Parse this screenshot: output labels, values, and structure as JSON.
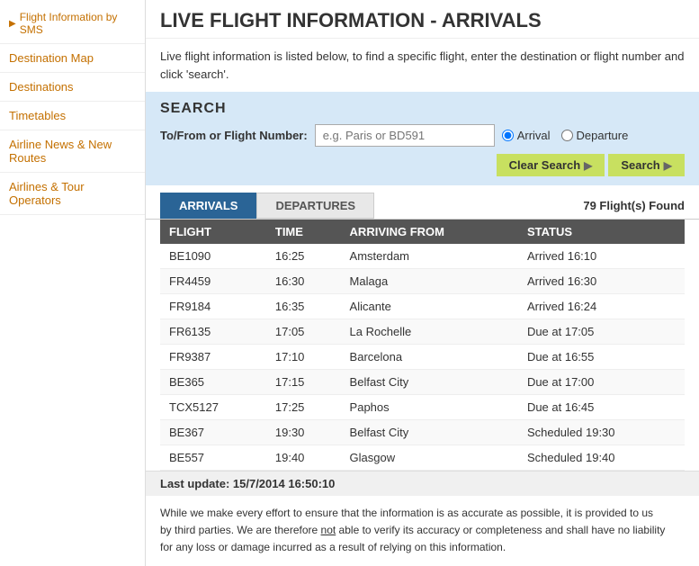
{
  "sidebar": {
    "items": [
      {
        "id": "flight-info-sms",
        "label": "Flight Information by SMS",
        "active": false,
        "hasArrow": true
      },
      {
        "id": "destination-map",
        "label": "Destination Map",
        "active": false
      },
      {
        "id": "destinations",
        "label": "Destinations",
        "active": false
      },
      {
        "id": "timetables",
        "label": "Timetables",
        "active": false
      },
      {
        "id": "airline-news",
        "label": "Airline News & New Routes",
        "active": false
      },
      {
        "id": "airlines-tour",
        "label": "Airlines & Tour Operators",
        "active": false
      }
    ]
  },
  "header": {
    "title": "LIVE FLIGHT INFORMATION - ARRIVALS"
  },
  "intro": {
    "text": "Live flight information is listed below, to find a specific flight, enter the destination or flight number and click 'search'."
  },
  "search": {
    "section_title": "SEARCH",
    "label": "To/From or Flight Number:",
    "placeholder": "e.g. Paris or BD591",
    "arrival_label": "Arrival",
    "departure_label": "Departure",
    "clear_label": "Clear Search",
    "search_label": "Search"
  },
  "tabs": {
    "arrivals": "ARRIVALS",
    "departures": "DEPARTURES",
    "flights_found": "79 Flight(s) Found"
  },
  "table": {
    "columns": [
      "FLIGHT",
      "TIME",
      "ARRIVING FROM",
      "STATUS"
    ],
    "rows": [
      {
        "flight": "BE1090",
        "time": "16:25",
        "from": "Amsterdam",
        "status": "Arrived 16:10",
        "status_type": "arrived"
      },
      {
        "flight": "FR4459",
        "time": "16:30",
        "from": "Malaga",
        "status": "Arrived 16:30",
        "status_type": "arrived"
      },
      {
        "flight": "FR9184",
        "time": "16:35",
        "from": "Alicante",
        "status": "Arrived 16:24",
        "status_type": "arrived"
      },
      {
        "flight": "FR6135",
        "time": "17:05",
        "from": "La Rochelle",
        "status": "Due at 17:05",
        "status_type": "due"
      },
      {
        "flight": "FR9387",
        "time": "17:10",
        "from": "Barcelona",
        "status": "Due at 16:55",
        "status_type": "due"
      },
      {
        "flight": "BE365",
        "time": "17:15",
        "from": "Belfast City",
        "status": "Due at 17:00",
        "status_type": "due"
      },
      {
        "flight": "TCX5127",
        "time": "17:25",
        "from": "Paphos",
        "status": "Due at 16:45",
        "status_type": "due"
      },
      {
        "flight": "BE367",
        "time": "19:30",
        "from": "Belfast City",
        "status": "Scheduled 19:30",
        "status_type": "scheduled"
      },
      {
        "flight": "BE557",
        "time": "19:40",
        "from": "Glasgow",
        "status": "Scheduled 19:40",
        "status_type": "scheduled"
      }
    ]
  },
  "last_update": {
    "text": "Last update: 15/7/2014 16:50:10"
  },
  "disclaimer": {
    "line1": "While we make every effort to ensure that the information is as accurate as possible, it is provided to us",
    "line2": "by third parties. We are therefore not able to verify its accuracy or completeness and shall have no liability",
    "line3": "for any loss or damage incurred as a result of relying on this information."
  }
}
